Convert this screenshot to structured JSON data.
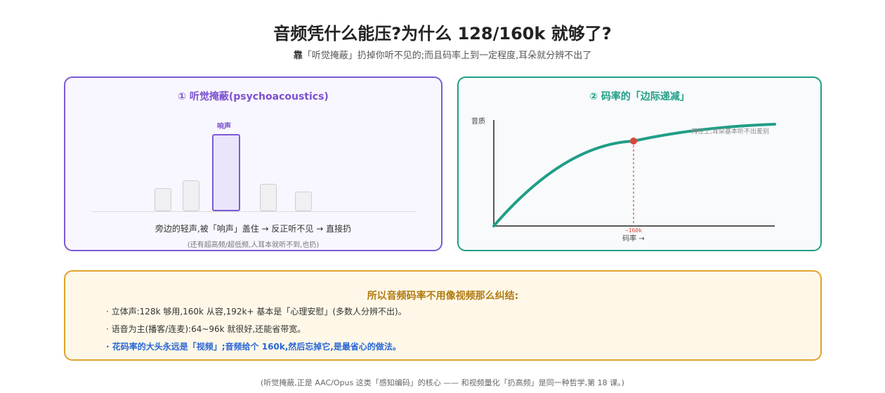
{
  "header": {
    "title": "音频凭什么能压?为什么 128/160k 就够了?",
    "subtitle_lead": "靠",
    "subtitle_rest": "「听觉掩蔽」扔掉你听不见的;而且码率上到一定程度,耳朵就分辨不出了"
  },
  "masking": {
    "title": "① 听觉掩蔽(psychoacoustics)",
    "loud_label": "响声",
    "caption": "旁边的轻声,被「响声」盖住 → 反正听不见 → 直接扔",
    "note": "(还有超高频/超低频,人耳本就听不到,也扔)",
    "bars": [
      {
        "name": "quiet-1",
        "level": 0.3
      },
      {
        "name": "quiet-2",
        "level": 0.4
      },
      {
        "name": "loud",
        "level": 1.0
      },
      {
        "name": "quiet-3",
        "level": 0.35
      },
      {
        "name": "quiet-4",
        "level": 0.25
      }
    ]
  },
  "returns": {
    "title": "② 码率的「边际递减」",
    "ylabel": "音质",
    "xlabel": "码率 →",
    "marker_label": "~160k",
    "annotation": "再往上,耳朵基本听不出差别",
    "colors": {
      "curve": "#1f9e86",
      "marker": "#d9453b"
    }
  },
  "summary": {
    "heading": "所以音频码率不用像视频那么纠结:",
    "bullets": [
      "· 立体声:128k 够用,160k 从容,192k+ 基本是「心理安慰」(多数人分辨不出)。",
      "· 语音为主(播客/连麦):64~96k 就很好,还能省带宽。",
      "· 花码率的大头永远是「视频」;音频给个 160k,然后忘掉它,是最省心的做法。"
    ]
  },
  "footer": "(听觉掩蔽,正是 AAC/Opus 这类「感知编码」的核心 —— 和视频量化「扔高频」是同一种哲学,第 18 课。)"
}
